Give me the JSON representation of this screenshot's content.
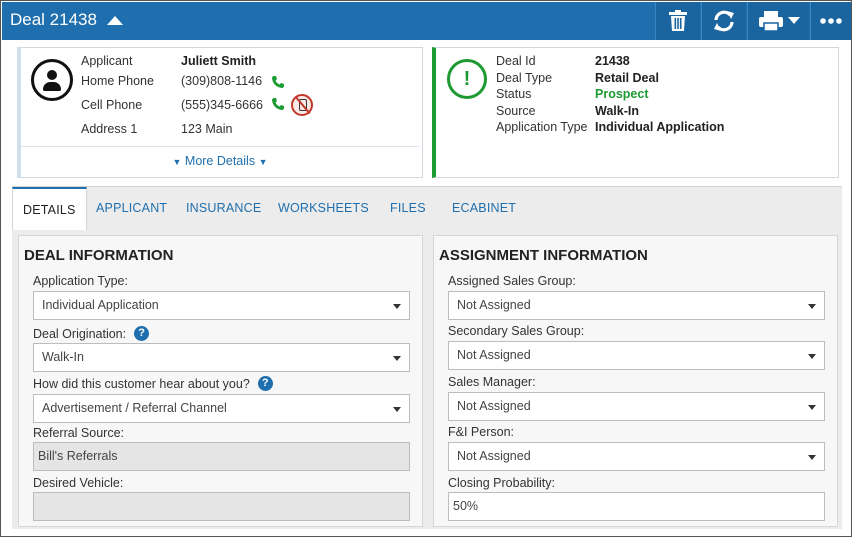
{
  "header": {
    "title": "Deal 21438",
    "icons": [
      "trash-icon",
      "refresh-icon",
      "print-icon",
      "more-icon"
    ],
    "accent_color": "#1f6fae"
  },
  "applicant_card": {
    "rows": [
      {
        "label": "Applicant",
        "value": "Juliett Smith"
      },
      {
        "label": "Home Phone",
        "value": "(309)808-1146"
      },
      {
        "label": "Cell Phone",
        "value": "(555)345-6666"
      },
      {
        "label": "Address 1",
        "value": "123 Main"
      }
    ],
    "more_details": "More Details"
  },
  "deal_card": {
    "rows": [
      {
        "label": "Deal Id",
        "value": "21438"
      },
      {
        "label": "Deal Type",
        "value": "Retail Deal"
      },
      {
        "label": "Status",
        "value": "Prospect"
      },
      {
        "label": "Source",
        "value": "Walk-In"
      },
      {
        "label": "Application Type",
        "value": "Individual Application"
      }
    ],
    "status_color": "#1e9a33"
  },
  "tabs": [
    {
      "label": "DETAILS",
      "active": true
    },
    {
      "label": "APPLICANT",
      "active": false
    },
    {
      "label": "INSURANCE",
      "active": false
    },
    {
      "label": "WORKSHEETS",
      "active": false
    },
    {
      "label": "FILES",
      "active": false
    },
    {
      "label": "ECABINET",
      "active": false
    }
  ],
  "deal_info": {
    "title": "DEAL INFORMATION",
    "application_type": {
      "label": "Application Type:",
      "value": "Individual Application"
    },
    "deal_origination": {
      "label": "Deal Origination:",
      "value": "Walk-In"
    },
    "hear_about": {
      "label": "How did this customer hear about you?",
      "value": "Advertisement / Referral Channel"
    },
    "referral_source": {
      "label": "Referral Source:",
      "value": "Bill's Referrals"
    },
    "desired_vehicle": {
      "label": "Desired Vehicle:",
      "value": ""
    }
  },
  "assignment_info": {
    "title": "ASSIGNMENT INFORMATION",
    "assigned_sales_group": {
      "label": "Assigned Sales Group:",
      "value": "Not Assigned"
    },
    "secondary_sales_group": {
      "label": "Secondary Sales Group:",
      "value": "Not Assigned"
    },
    "sales_manager": {
      "label": "Sales Manager:",
      "value": "Not Assigned"
    },
    "fi_person": {
      "label": "F&I Person:",
      "value": "Not Assigned"
    },
    "closing_probability": {
      "label": "Closing Probability:",
      "value": "50%"
    }
  }
}
